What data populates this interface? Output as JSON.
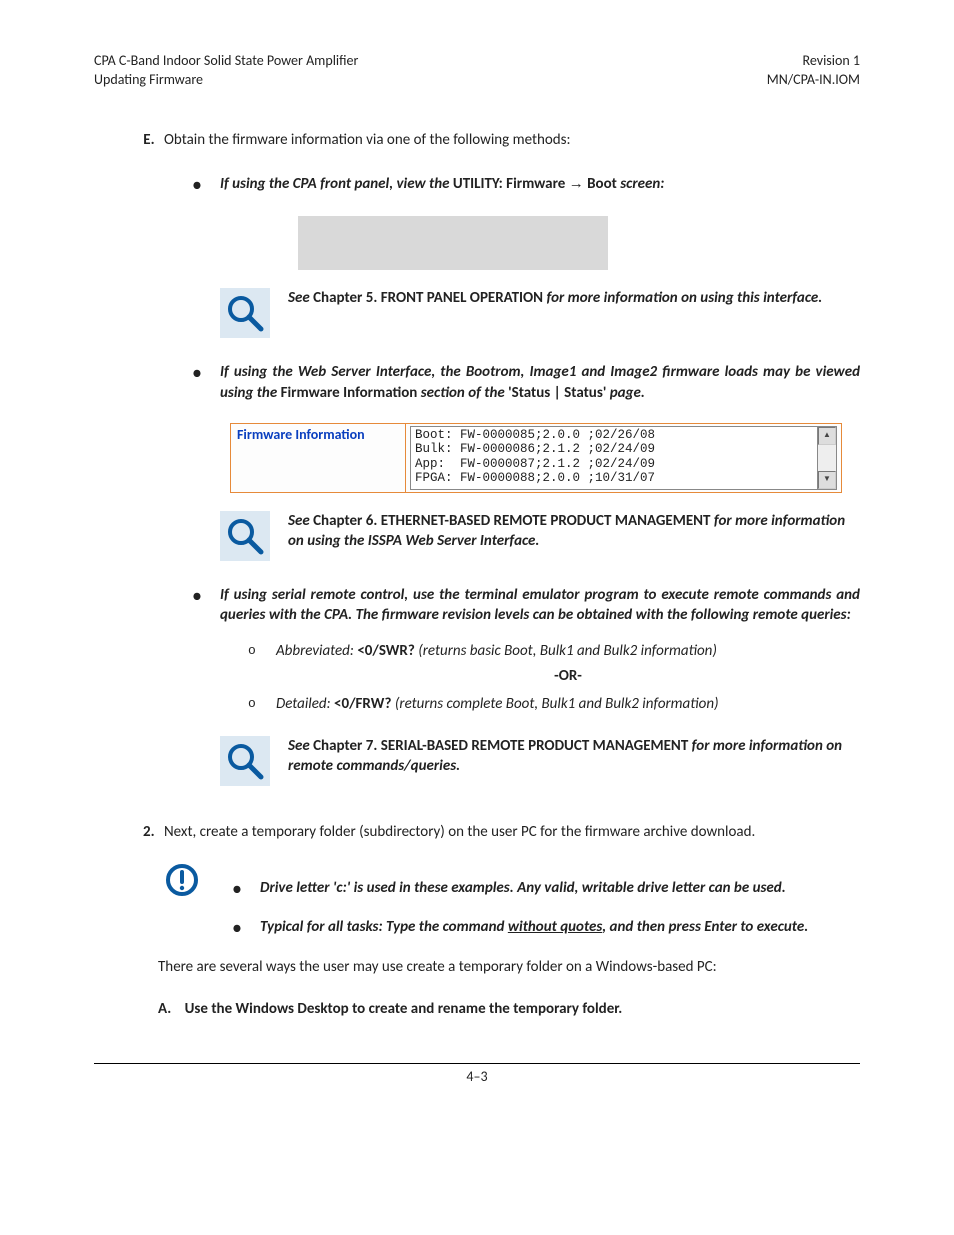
{
  "header": {
    "left_line1": "CPA C-Band Indoor Solid State Power Amplifier",
    "left_line2": "Updating Firmware",
    "right_line1": "Revision 1",
    "right_line2": "MN/CPA-IN.IOM"
  },
  "E": {
    "title": "Obtain the firmware information via one of the following methods:",
    "b1": {
      "pre": "If using the CPA front panel, view the ",
      "util": "UTILITY: Firmware ",
      "boot": " Boot ",
      "screen": "screen:"
    },
    "see1": {
      "see": "See ",
      "ch": "Chapter 5. FRONT PANEL OPERATION ",
      "rest": "for more information on using this interface."
    },
    "b2": {
      "pre": "If using the Web Server Interface, the Bootrom, Image1 and Image2 firmware loads may be viewed using the ",
      "fi": "Firmware Information ",
      "mid": "section of the ",
      "ss": "'Status | Status' ",
      "end": "page."
    },
    "fw": {
      "label": "Firmware Information",
      "blob": "Boot: FW-0000085;2.0.0 ;02/26/08\nBulk: FW-0000086;2.1.2 ;02/24/09\nApp:  FW-0000087;2.1.2 ;02/24/09\nFPGA: FW-0000088;2.0.0 ;10/31/07"
    },
    "see2": {
      "see": "See ",
      "ch": "Chapter 6. ETHERNET-BASED REMOTE PRODUCT MANAGEMENT ",
      "rest": "for more information on using the ISSPA Web Server Interface."
    },
    "b3": {
      "pre": "If using serial remote control",
      "rest": ", use the terminal emulator program to execute remote commands and queries with the CPA. The firmware revision levels can be obtained with the following remote queries:"
    },
    "sub": {
      "abbr_pre": "Abbreviated: ",
      "abbr_cmd": "<0/SWR? ",
      "abbr_rest": "(returns basic Boot, Bulk1 and Bulk2 information)",
      "or": "-OR-",
      "det_pre": "Detailed: ",
      "det_cmd": "<0/FRW? ",
      "det_rest": "(returns complete Boot, Bulk1 and Bulk2 information)"
    },
    "see3": {
      "see": "See ",
      "ch": "Chapter 7. SERIAL-BASED REMOTE PRODUCT MANAGEMENT ",
      "rest": "for more information on remote commands/queries."
    }
  },
  "step2": {
    "text": "Next, create a temporary folder (subdirectory) on the user PC for the firmware archive download.",
    "note1_pre": "Drive letter 'c:' is used in these examples. Any valid, writable drive letter can be used.",
    "note2_pre": "Typical for all tasks: Type the command ",
    "note2_u": "without quotes",
    "note2_post": ", and then press Enter to execute.",
    "after": "There are several ways the user may use create a temporary folder on a Windows-based PC:",
    "A": "Use the Windows Desktop to create and rename the temporary folder."
  },
  "footer": "4–3"
}
